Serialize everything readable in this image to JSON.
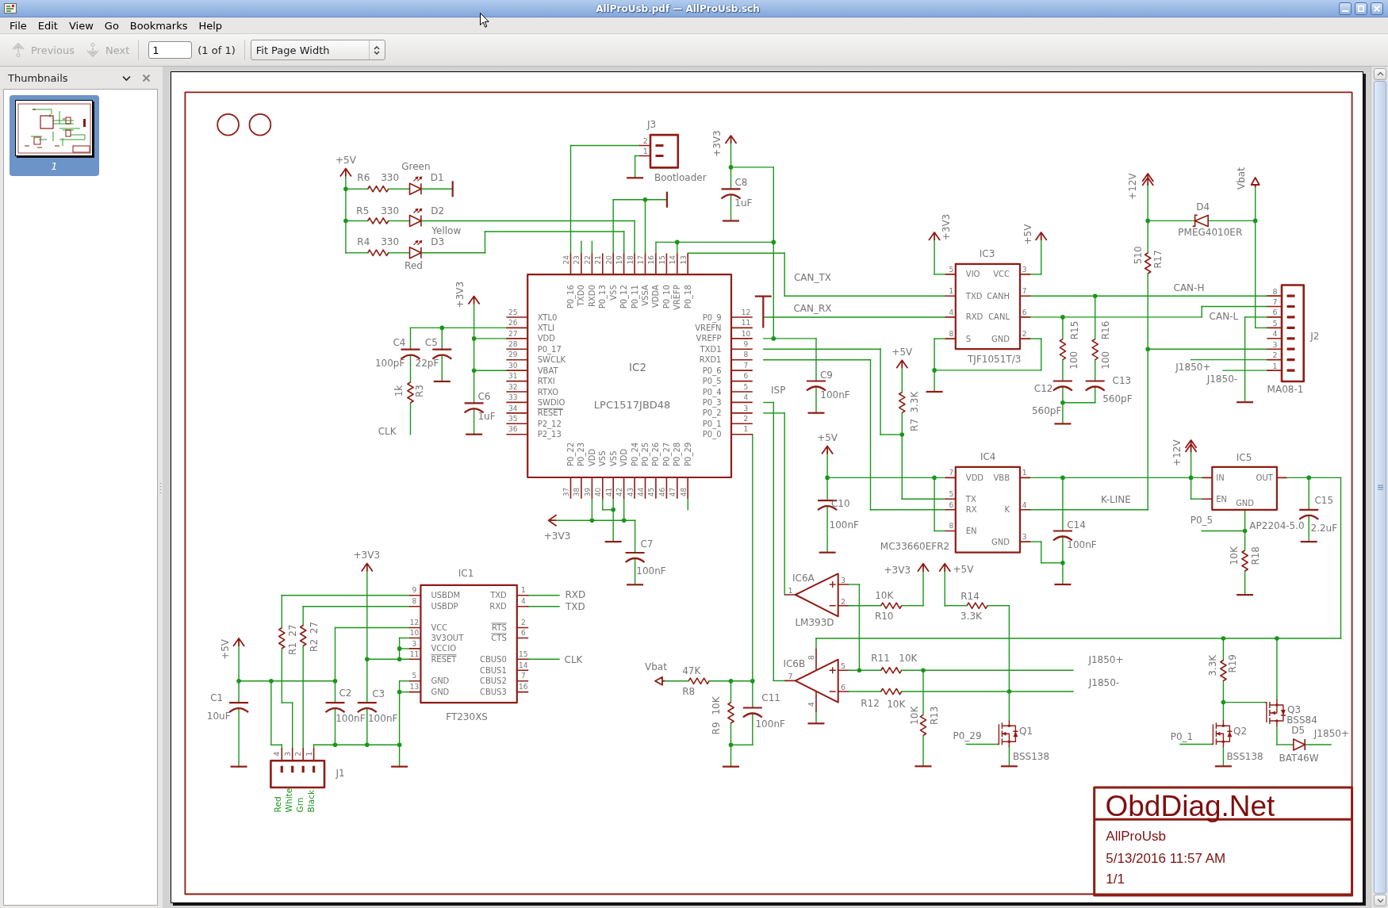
{
  "window": {
    "title": "AllProUsb.pdf — AllProUsb.sch"
  },
  "menu": [
    {
      "label": "File"
    },
    {
      "label": "Edit"
    },
    {
      "label": "View"
    },
    {
      "label": "Go"
    },
    {
      "label": "Bookmarks"
    },
    {
      "label": "Help"
    }
  ],
  "toolbar": {
    "previous": {
      "label": "Previous",
      "disabled": true
    },
    "next": {
      "label": "Next",
      "disabled": true
    },
    "page_field": {
      "value": "1"
    },
    "page_count": "(1 of 1)",
    "zoom_select": {
      "value": "Fit Page Width"
    }
  },
  "sidebar": {
    "title": "Thumbnails",
    "thumbnails": [
      {
        "label": "1",
        "selected": true
      }
    ]
  },
  "schematic": {
    "ics": [
      {
        "ref": "IC2",
        "part": "LPC1517JBD48",
        "pins": {
          "left": [
            {
              "number": "25",
              "name": "XTL0",
              "overline": false
            },
            {
              "number": "26",
              "name": "XTLI",
              "overline": false
            },
            {
              "number": "27",
              "name": "VDD",
              "overline": false
            },
            {
              "number": "28",
              "name": "P0_17",
              "overline": false
            },
            {
              "number": "29",
              "name": "SWCLK",
              "overline": false
            },
            {
              "number": "30",
              "name": "VBAT",
              "overline": false
            },
            {
              "number": "31",
              "name": "RTXI",
              "overline": false
            },
            {
              "number": "32",
              "name": "RTXO",
              "overline": false
            },
            {
              "number": "33",
              "name": "SWDIO",
              "overline": false
            },
            {
              "number": "34",
              "name": "RESET",
              "overline": true
            },
            {
              "number": "35",
              "name": "P2_12",
              "overline": false
            },
            {
              "number": "36",
              "name": "P2_13",
              "overline": false
            }
          ],
          "right": [
            {
              "number": "12",
              "name": "P0_9",
              "overline": false
            },
            {
              "number": "11",
              "name": "VREFN",
              "overline": false
            },
            {
              "number": "10",
              "name": "VREFP",
              "overline": false
            },
            {
              "number": "9",
              "name": "TXD1",
              "overline": false
            },
            {
              "number": "8",
              "name": "RXD1",
              "overline": false
            },
            {
              "number": "7",
              "name": "P0_6",
              "overline": false
            },
            {
              "number": "6",
              "name": "P0_5",
              "overline": false
            },
            {
              "number": "5",
              "name": "P0_4",
              "overline": false
            },
            {
              "number": "4",
              "name": "P0_3",
              "overline": false
            },
            {
              "number": "3",
              "name": "P0_2",
              "overline": false
            },
            {
              "number": "2",
              "name": "P0_1",
              "overline": false
            },
            {
              "number": "1",
              "name": "P0_0",
              "overline": false
            }
          ],
          "top": [
            {
              "number": "24",
              "name": "P0_16",
              "overline": false
            },
            {
              "number": "23",
              "name": "TXD0",
              "overline": false
            },
            {
              "number": "22",
              "name": "RXD0",
              "overline": false
            },
            {
              "number": "21",
              "name": "P0_13",
              "overline": false
            },
            {
              "number": "20",
              "name": "VSS",
              "overline": false
            },
            {
              "number": "19",
              "name": "P0_12",
              "overline": false
            },
            {
              "number": "18",
              "name": "P0_11",
              "overline": false
            },
            {
              "number": "17",
              "name": "VSSA",
              "overline": false
            },
            {
              "number": "16",
              "name": "VDDA",
              "overline": false
            },
            {
              "number": "15",
              "name": "P0_10",
              "overline": false
            },
            {
              "number": "14",
              "name": "VREFP",
              "overline": false
            },
            {
              "number": "13",
              "name": "P0_18",
              "overline": false
            }
          ],
          "bottom": [
            {
              "number": "37",
              "name": "P0_22",
              "overline": false
            },
            {
              "number": "38",
              "name": "P0_23",
              "overline": false
            },
            {
              "number": "39",
              "name": "VDD",
              "overline": false
            },
            {
              "number": "40",
              "name": "VSS",
              "overline": false
            },
            {
              "number": "41",
              "name": "VSS",
              "overline": false
            },
            {
              "number": "42",
              "name": "VDD",
              "overline": false
            },
            {
              "number": "43",
              "name": "P0_24",
              "overline": false
            },
            {
              "number": "44",
              "name": "P0_25",
              "overline": false
            },
            {
              "number": "45",
              "name": "P0_26",
              "overline": false
            },
            {
              "number": "46",
              "name": "P0_27",
              "overline": false
            },
            {
              "number": "47",
              "name": "P0_28",
              "overline": false
            },
            {
              "number": "48",
              "name": "P0_29",
              "overline": false
            }
          ]
        }
      },
      {
        "ref": "IC3",
        "part": "TJF1051T/3",
        "pins": {
          "left": [
            {
              "number": "5",
              "name": "VIO",
              "overline": false
            },
            {
              "number": "1",
              "name": "TXD",
              "overline": false
            },
            {
              "number": "4",
              "name": "RXD",
              "overline": false
            },
            {
              "number": "8",
              "name": "S",
              "overline": false
            }
          ],
          "right": [
            {
              "number": "3",
              "name": "VCC",
              "overline": false
            },
            {
              "number": "7",
              "name": "CANH",
              "overline": false
            },
            {
              "number": "6",
              "name": "CANL",
              "overline": false
            },
            {
              "number": "2",
              "name": "GND",
              "overline": false
            }
          ]
        }
      },
      {
        "ref": "IC4",
        "part": "MC33660EFR2",
        "pins": {
          "left": [
            {
              "number": "7",
              "name": "VDD",
              "overline": false
            },
            {
              "number": "5",
              "name": "TX",
              "overline": false
            },
            {
              "number": "6",
              "name": "RX",
              "overline": false
            },
            {
              "number": "8",
              "name": "EN",
              "overline": false
            }
          ],
          "right": [
            {
              "number": "1",
              "name": "VBB",
              "overline": false
            },
            {
              "number": "4",
              "name": "K",
              "overline": false
            },
            {
              "number": "3",
              "name": "GND",
              "overline": false
            }
          ]
        }
      },
      {
        "ref": "IC5",
        "part": "AP2204-5.0",
        "pins": {
          "left": [
            {
              "name": "IN",
              "overline": false
            },
            {
              "name": "EN",
              "overline": false
            }
          ],
          "right": [
            {
              "name": "OUT",
              "overline": false
            }
          ],
          "bottom": [
            {
              "name": "GND",
              "overline": false
            }
          ]
        }
      },
      {
        "ref": "IC1",
        "part": "FT230XS",
        "pins": {
          "left": [
            {
              "number": "9",
              "name": "USBDM",
              "overline": false
            },
            {
              "number": "8",
              "name": "USBDP",
              "overline": false
            },
            {
              "number": "12",
              "name": "VCC",
              "overline": false
            },
            {
              "number": "10",
              "name": "3V3OUT",
              "overline": false
            },
            {
              "number": "3",
              "name": "VCCIO",
              "overline": false
            },
            {
              "number": "11",
              "name": "RESET",
              "overline": true
            },
            {
              "number": "5",
              "name": "GND",
              "overline": false
            },
            {
              "number": "13",
              "name": "GND",
              "overline": false
            }
          ],
          "right": [
            {
              "number": "1",
              "name": "TXD",
              "overline": false
            },
            {
              "number": "4",
              "name": "RXD",
              "overline": false
            },
            {
              "number": "2",
              "name": "RTS",
              "overline": true
            },
            {
              "number": "6",
              "name": "CTS",
              "overline": true
            },
            {
              "number": "15",
              "name": "CBUS0",
              "overline": false
            },
            {
              "number": "14",
              "name": "CBUS1",
              "overline": false
            },
            {
              "number": "7",
              "name": "CBUS2",
              "overline": false
            },
            {
              "number": "16",
              "name": "CBUS3",
              "overline": false
            }
          ]
        }
      }
    ],
    "opamps": [
      {
        "ref": "IC6A",
        "part": "LM393D",
        "pins": [
          "3",
          "2",
          "1"
        ]
      },
      {
        "ref": "IC6B",
        "pins": [
          "5",
          "6",
          "7",
          "8",
          "4"
        ]
      }
    ],
    "parts": [
      {
        "kind": "resistor",
        "ref": "R6",
        "value": "330"
      },
      {
        "kind": "led",
        "ref": "D1",
        "value": "Green"
      },
      {
        "kind": "resistor",
        "ref": "R5",
        "value": "330"
      },
      {
        "kind": "led",
        "ref": "D2",
        "value": "Yellow"
      },
      {
        "kind": "resistor",
        "ref": "R4",
        "value": "330"
      },
      {
        "kind": "led",
        "ref": "D3",
        "value": "Red"
      },
      {
        "kind": "connector",
        "ref": "J3",
        "value": "Bootloader",
        "pins": [
          "2",
          "1"
        ]
      },
      {
        "kind": "capacitor",
        "ref": "C8",
        "value": "1uF"
      },
      {
        "kind": "capacitor",
        "ref": "C4",
        "value": "100pF"
      },
      {
        "kind": "capacitor",
        "ref": "C5",
        "value": "22pF"
      },
      {
        "kind": "resistor",
        "ref": "R3",
        "value": "1k"
      },
      {
        "kind": "capacitor",
        "ref": "C6",
        "value": "1uF"
      },
      {
        "kind": "capacitor",
        "ref": "C9",
        "value": "100nF"
      },
      {
        "kind": "resistor",
        "ref": "R15",
        "value": "100"
      },
      {
        "kind": "resistor",
        "ref": "R16",
        "value": "100"
      },
      {
        "kind": "capacitor",
        "ref": "C12",
        "value": "560pF"
      },
      {
        "kind": "capacitor",
        "ref": "C13",
        "value": "560pF"
      },
      {
        "kind": "resistor",
        "ref": "R17",
        "value": "510"
      },
      {
        "kind": "schottky",
        "ref": "D4",
        "value": "PMEG4010ER"
      },
      {
        "kind": "connector",
        "ref": "J2",
        "value": "MA08-1",
        "pins": [
          "8",
          "7",
          "6",
          "5",
          "4",
          "3",
          "2",
          "1"
        ]
      },
      {
        "kind": "resistor",
        "ref": "R7",
        "value": "3.3K"
      },
      {
        "kind": "capacitor",
        "ref": "C10",
        "value": "100nF"
      },
      {
        "kind": "capacitor",
        "ref": "C14",
        "value": "100nF"
      },
      {
        "kind": "resistor",
        "ref": "R18",
        "value": "10K"
      },
      {
        "kind": "capacitor",
        "ref": "C15",
        "value": "2.2uF"
      },
      {
        "kind": "capacitor",
        "ref": "C7",
        "value": "100nF"
      },
      {
        "kind": "resistor",
        "ref": "R1",
        "value": "27"
      },
      {
        "kind": "resistor",
        "ref": "R2",
        "value": "27"
      },
      {
        "kind": "capacitor",
        "ref": "C1",
        "value": "10uF"
      },
      {
        "kind": "capacitor",
        "ref": "C2",
        "value": "100nF"
      },
      {
        "kind": "capacitor",
        "ref": "C3",
        "value": "100nF"
      },
      {
        "kind": "connector",
        "ref": "J1",
        "pins": [
          "4",
          "3",
          "2",
          "1"
        ],
        "pin_labels": [
          "Red",
          "White",
          "Grn",
          "Black"
        ]
      },
      {
        "kind": "resistor",
        "ref": "R8",
        "value": "47K"
      },
      {
        "kind": "resistor",
        "ref": "R9",
        "value": "10K"
      },
      {
        "kind": "capacitor",
        "ref": "C11",
        "value": "100nF"
      },
      {
        "kind": "resistor",
        "ref": "R10",
        "value": "10K"
      },
      {
        "kind": "resistor",
        "ref": "R14",
        "value": "3.3K"
      },
      {
        "kind": "resistor",
        "ref": "R11",
        "value": "10K"
      },
      {
        "kind": "resistor",
        "ref": "R12",
        "value": "10K"
      },
      {
        "kind": "resistor",
        "ref": "R13",
        "value": "10K"
      },
      {
        "kind": "n_mosfet",
        "ref": "Q1",
        "value": "BSS138"
      },
      {
        "kind": "resistor",
        "ref": "R19",
        "value": "3.3K"
      },
      {
        "kind": "n_mosfet",
        "ref": "Q2",
        "value": "BSS138"
      },
      {
        "kind": "p_mosfet",
        "ref": "Q3",
        "value": "BSS84"
      },
      {
        "kind": "diode",
        "ref": "D5",
        "value": "BAT46W"
      }
    ],
    "power_labels": [
      {
        "kind": "arrow",
        "label": "+5V"
      },
      {
        "kind": "arrow",
        "label": "+3V3"
      },
      {
        "kind": "arrow",
        "label": "+3V3"
      },
      {
        "kind": "arrow",
        "label": "+3V3"
      },
      {
        "kind": "arrow",
        "label": "+5V"
      },
      {
        "kind": "double_arrow",
        "label": "+12V"
      },
      {
        "kind": "flag",
        "label": "Vbat"
      },
      {
        "kind": "arrow",
        "label": "+5V"
      },
      {
        "kind": "arrow",
        "label": "+5V"
      },
      {
        "kind": "double_arrow",
        "label": "+12V"
      },
      {
        "kind": "arrow",
        "label": "+3V3"
      },
      {
        "kind": "arrow",
        "label": "+3V3"
      },
      {
        "kind": "arrow",
        "label": "+5V"
      },
      {
        "kind": "flag",
        "label": "Vbat"
      },
      {
        "kind": "arrow",
        "label": "+3V3"
      },
      {
        "kind": "arrow",
        "label": "+5V"
      }
    ],
    "net_labels": [
      "CAN_TX",
      "CAN_RX",
      "CLK",
      "ISP",
      "CAN-H",
      "CAN-L",
      "J1850+",
      "J1850-",
      "K-LINE",
      "P0_5",
      "RXD",
      "TXD",
      "CLK",
      "J1850+",
      "J1850-",
      "P0_29",
      "P0_1",
      "J1850+"
    ],
    "title_block": {
      "company": "ObdDiag.Net",
      "project": "AllProUsb",
      "date": "5/13/2016 11:57 AM",
      "sheet": "1/1"
    }
  }
}
